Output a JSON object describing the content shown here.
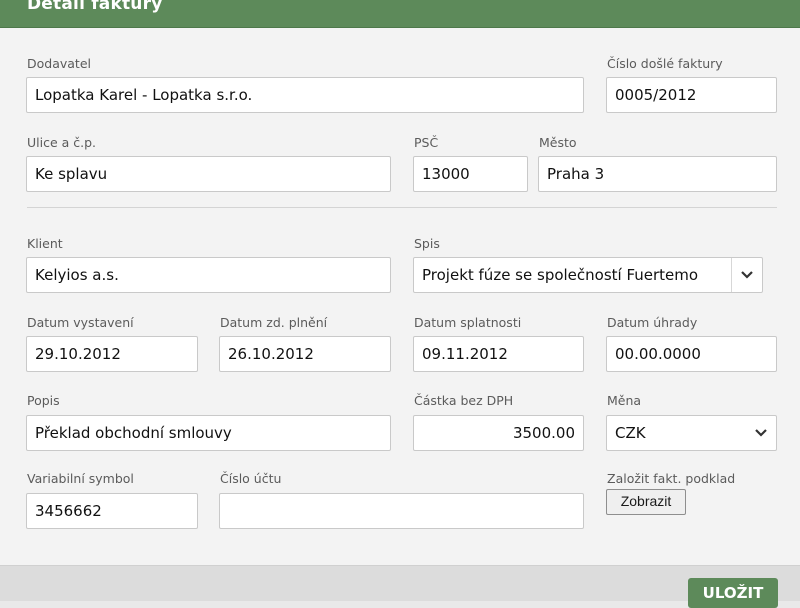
{
  "dialog": {
    "title": "Detail faktury"
  },
  "supplier": {
    "label": "Dodavatel",
    "value": "Lopatka Karel - Lopatka s.r.o."
  },
  "invoice_number": {
    "label": "Číslo došlé faktury",
    "value": "0005/2012"
  },
  "street": {
    "label": "Ulice a č.p.",
    "value": "Ke splavu"
  },
  "zip": {
    "label": "PSČ",
    "value": "13000"
  },
  "city": {
    "label": "Město",
    "value": "Praha 3"
  },
  "client": {
    "label": "Klient",
    "value": "Kelyios a.s."
  },
  "file": {
    "label": "Spis",
    "value": "Projekt fúze se společností Fuertemo"
  },
  "issue_date": {
    "label": "Datum vystavení",
    "value": "29.10.2012"
  },
  "taxable_date": {
    "label": "Datum zd. plnění",
    "value": "26.10.2012"
  },
  "due_date": {
    "label": "Datum splatnosti",
    "value": "09.11.2012"
  },
  "payment_date": {
    "label": "Datum úhrady",
    "value": "00.00.0000"
  },
  "description": {
    "label": "Popis",
    "value": "Překlad obchodní smlouvy"
  },
  "amount": {
    "label": "Částka bez DPH",
    "value": "3500.00"
  },
  "currency": {
    "label": "Měna",
    "value": "CZK"
  },
  "variable_symbol": {
    "label": "Variabilní symbol",
    "value": "3456662"
  },
  "account": {
    "label": "Číslo účtu",
    "value": ""
  },
  "create_base": {
    "label": "Založit fakt. podklad",
    "button": "Zobrazit"
  },
  "footer": {
    "save_label": "ULOŽIT"
  },
  "colors": {
    "accent": "#5d8a5a",
    "panel": "#f3f3f3"
  }
}
